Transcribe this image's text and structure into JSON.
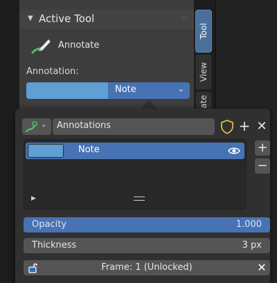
{
  "panel": {
    "title": "Active Tool",
    "tool_name": "Annotate",
    "annotation_label": "Annotation:",
    "annotation_value": "Note",
    "accent_color": "#5e9fd4"
  },
  "tabs": [
    {
      "label": "Tool",
      "active": true
    },
    {
      "label": "View",
      "active": false
    },
    {
      "label": "ate",
      "active": false
    }
  ],
  "popover": {
    "datablock_name": "Annotations",
    "layers": [
      {
        "name": "Note",
        "color": "#5e9fd4",
        "visible": true
      }
    ],
    "opacity_label": "Opacity",
    "opacity_value": "1.000",
    "thickness_label": "Thickness",
    "thickness_value": "3 px",
    "frame_text": "Frame: 1 (Unlocked)"
  },
  "icons": {
    "grip": "drag-grip-icon",
    "pen": "annotate-pen-icon",
    "shield": "fake-user-shield-icon",
    "eye": "eye-icon",
    "lock": "unlocked-icon"
  }
}
